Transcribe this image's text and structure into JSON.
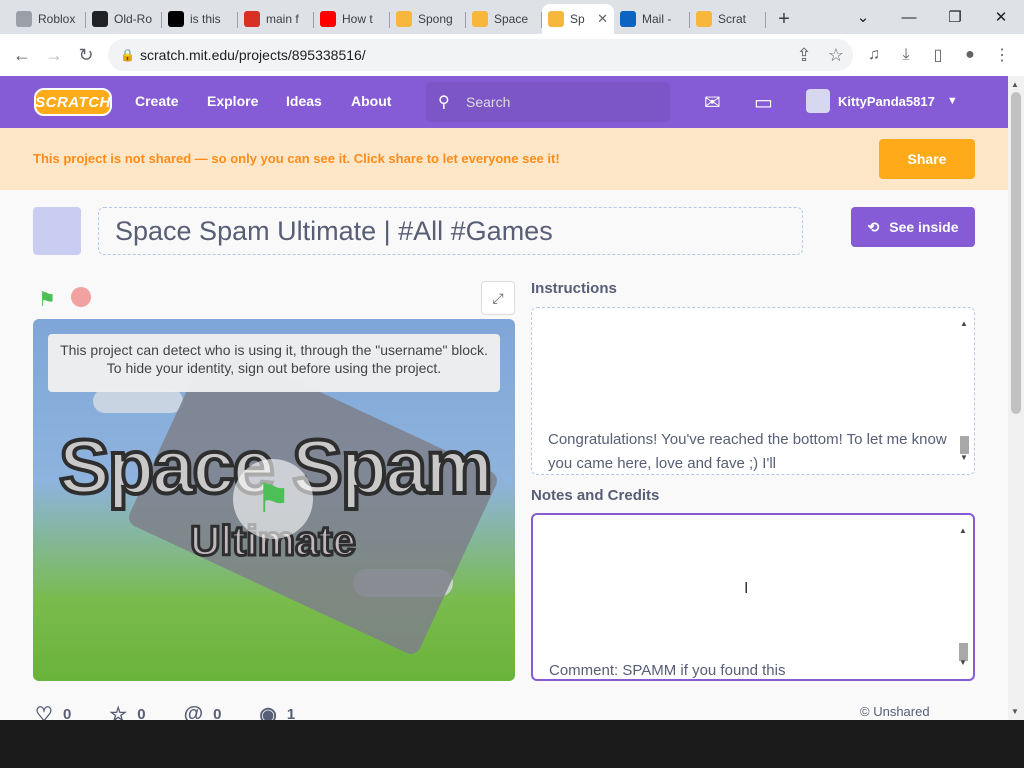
{
  "browser": {
    "tabs": [
      {
        "label": "Roblox",
        "fav_color": "#9aa0a6",
        "icon": "roblox-icon"
      },
      {
        "label": "Old-Ro",
        "fav_color": "#202124",
        "icon": "github-icon"
      },
      {
        "label": "is this",
        "fav_color": "#000000",
        "icon": "tiktok-icon"
      },
      {
        "label": "main f",
        "fav_color": "#d93025",
        "icon": "bookmark-icon"
      },
      {
        "label": "How t",
        "fav_color": "#ff0000",
        "icon": "youtube-icon"
      },
      {
        "label": "Spong",
        "fav_color": "#f6b73c",
        "icon": "scratch-icon"
      },
      {
        "label": "Space",
        "fav_color": "#f6b73c",
        "icon": "scratch-icon"
      },
      {
        "label": "Sp",
        "fav_color": "#f6b73c",
        "icon": "scratch-icon",
        "active": true
      },
      {
        "label": "Mail -",
        "fav_color": "#0a64c2",
        "icon": "outlook-icon"
      },
      {
        "label": "Scrat",
        "fav_color": "#f6b73c",
        "icon": "scratch-icon"
      }
    ],
    "url": "scratch.mit.edu/projects/895338516/"
  },
  "nav": {
    "logo": "SCRATCH",
    "links": [
      "Create",
      "Explore",
      "Ideas",
      "About"
    ],
    "search_placeholder": "Search",
    "username": "KittyPanda5817"
  },
  "banner": {
    "message": "This project is not shared — so only you can see it. Click share to let everyone see it!",
    "share_label": "Share"
  },
  "project": {
    "title": "Space Spam Ultimate | #All #Games",
    "see_inside_label": "See inside",
    "stage_notice": "This project can detect who is using it, through the \"username\" block. To hide your identity, sign out before using the project.",
    "game_title": "Space Spam",
    "game_subtitle": "Ultimate",
    "instructions_label": "Instructions",
    "instructions_text": "Congratulations! You've reached the bottom! To let me know you came here, love and fave ;) I'll",
    "notes_label": "Notes and Credits",
    "notes_text": "Comment: SPAMM if you found this",
    "stats": {
      "loves": "0",
      "favorites": "0",
      "remixes": "0",
      "views": "1"
    },
    "status": "Unshared"
  },
  "colors": {
    "accent": "#855cd6",
    "orange": "#ffab19",
    "banner_bg": "#fde7c8"
  }
}
